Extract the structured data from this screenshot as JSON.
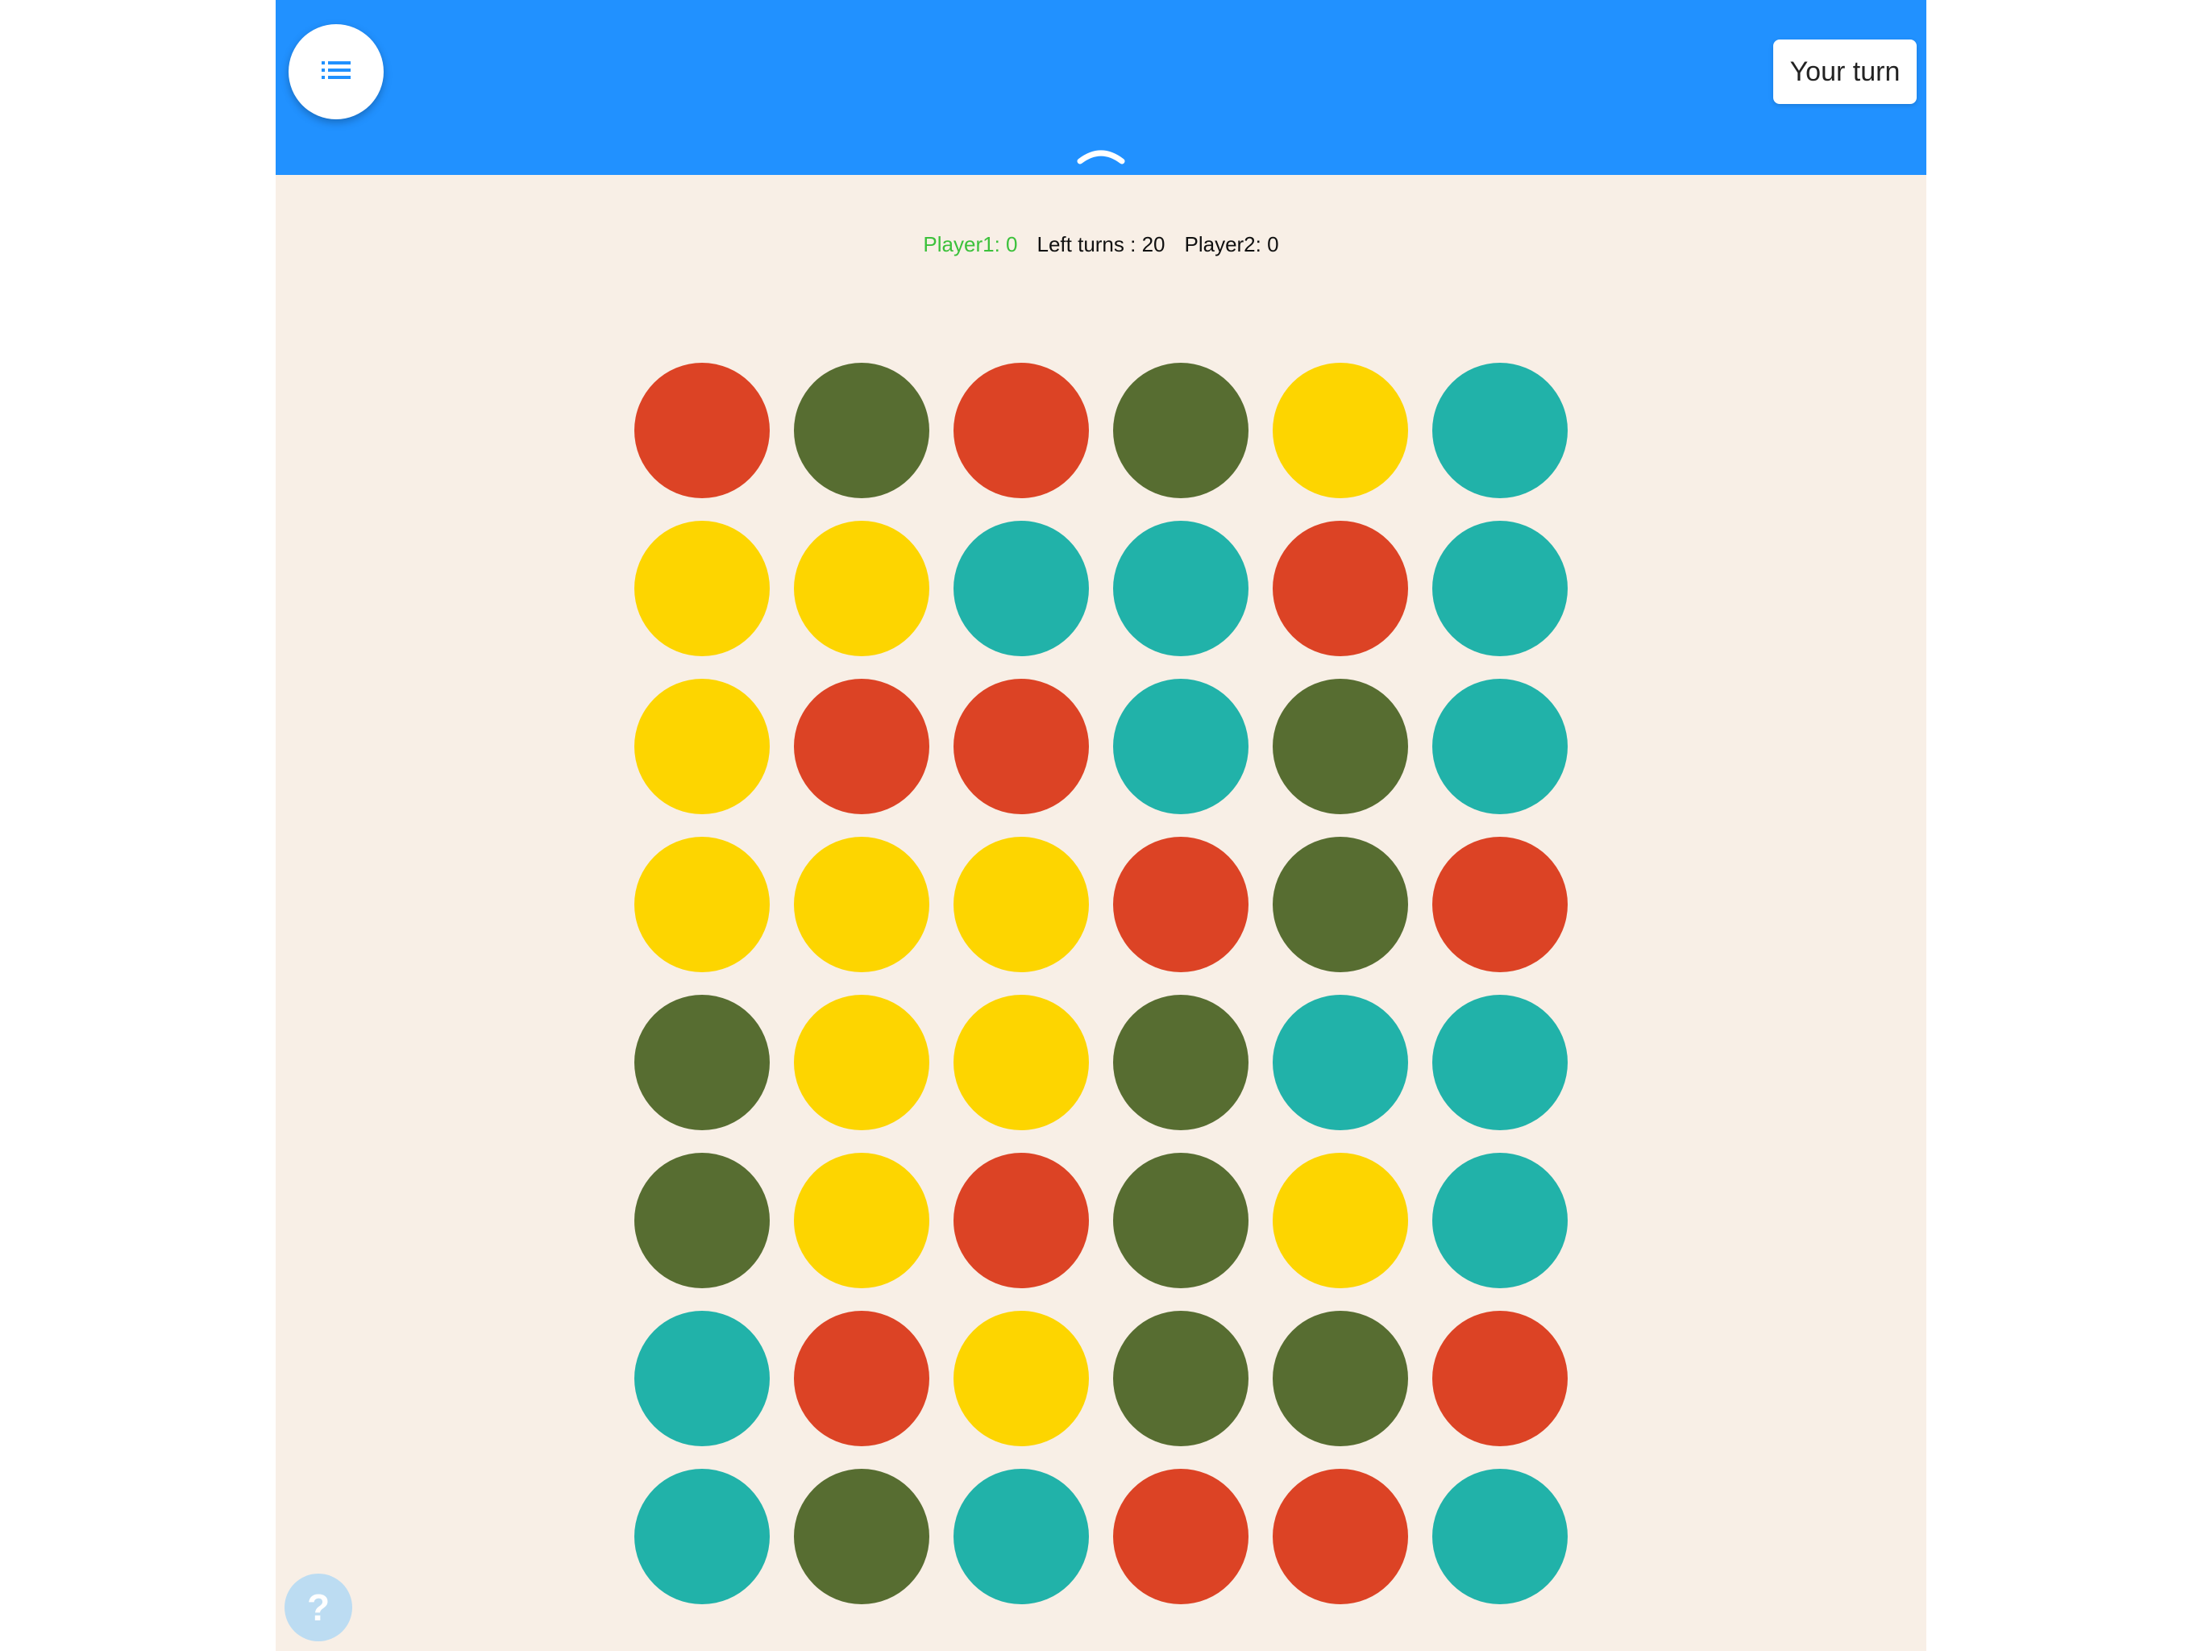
{
  "header": {
    "menu_icon": "list-icon",
    "turn_label": "Your turn",
    "collapse_icon": "chevron-up-icon",
    "accent_color": "#2191ff"
  },
  "scoreboard": {
    "player1": "Player1: 0",
    "left_turns": "Left turns : 20",
    "player2": "Player2: 0",
    "player1_color": "#3cc13b"
  },
  "board": {
    "rows": 8,
    "cols": 6,
    "palette": {
      "red": "#dc4325",
      "green": "#576d31",
      "yellow": "#fdd500",
      "teal": "#21b2a9"
    },
    "grid": [
      [
        "red",
        "green",
        "red",
        "green",
        "yellow",
        "teal"
      ],
      [
        "yellow",
        "yellow",
        "teal",
        "teal",
        "red",
        "teal"
      ],
      [
        "yellow",
        "red",
        "red",
        "teal",
        "green",
        "teal"
      ],
      [
        "yellow",
        "yellow",
        "yellow",
        "red",
        "green",
        "red"
      ],
      [
        "green",
        "yellow",
        "yellow",
        "green",
        "teal",
        "teal"
      ],
      [
        "green",
        "yellow",
        "red",
        "green",
        "yellow",
        "teal"
      ],
      [
        "teal",
        "red",
        "yellow",
        "green",
        "green",
        "red"
      ],
      [
        "teal",
        "green",
        "teal",
        "red",
        "red",
        "teal"
      ]
    ]
  },
  "help": {
    "label": "?",
    "icon": "question-icon"
  }
}
